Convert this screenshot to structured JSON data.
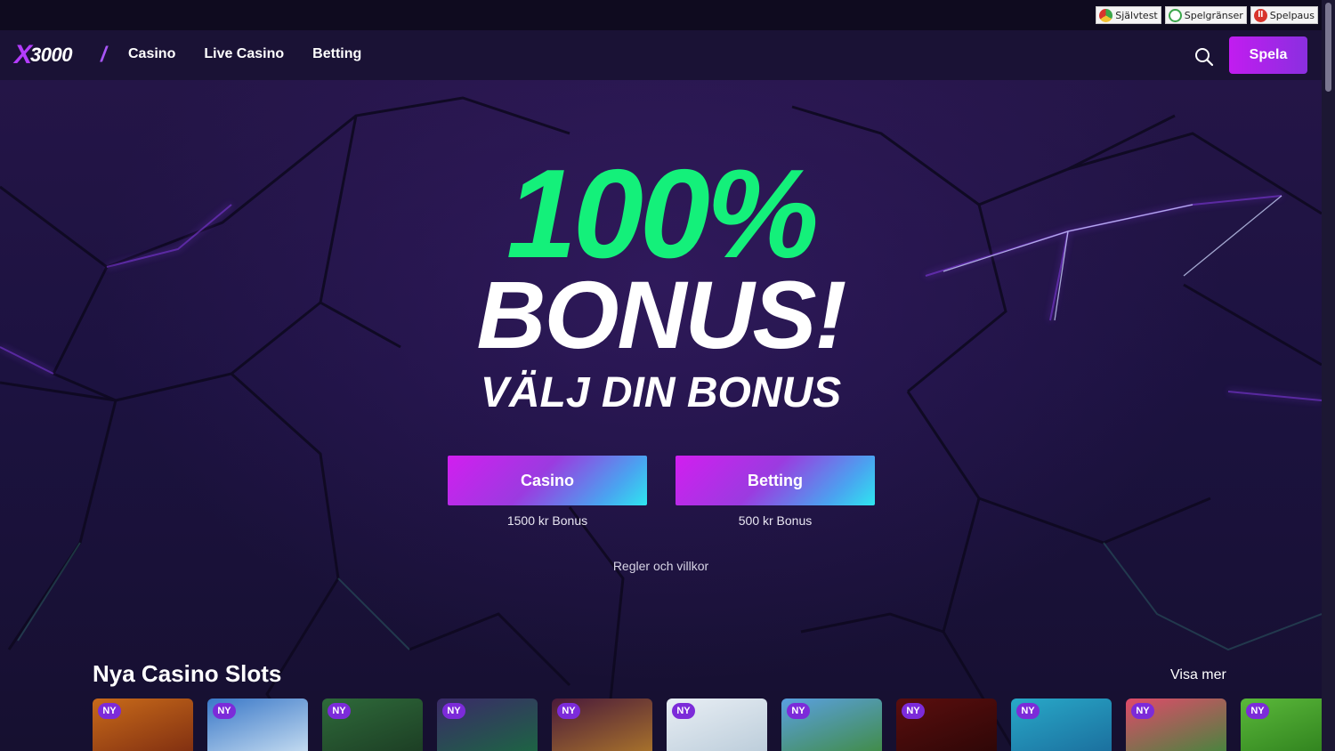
{
  "responsible_gaming": {
    "links": [
      {
        "label": "Självtest",
        "icon": "gauge-icon"
      },
      {
        "label": "Spelgränser",
        "icon": "limits-icon"
      },
      {
        "label": "Spelpaus",
        "icon": "pause-icon"
      }
    ]
  },
  "header": {
    "logo_x": "X",
    "logo_num": "3000",
    "nav": [
      {
        "label": "Casino"
      },
      {
        "label": "Live Casino"
      },
      {
        "label": "Betting"
      }
    ],
    "cta_label": "Spela"
  },
  "hero": {
    "headline_pct": "100%",
    "headline_bonus": "BONUS!",
    "headline_sub": "VÄLJ DIN BONUS",
    "options": [
      {
        "label": "Casino",
        "caption": "1500 kr Bonus"
      },
      {
        "label": "Betting",
        "caption": "500 kr Bonus"
      }
    ],
    "terms_label": "Regler och villkor"
  },
  "new_slots": {
    "title": "Nya Casino Slots",
    "see_more": "Visa mer",
    "badge": "NY",
    "tiles": [
      {
        "colors": [
          "#c86a1a",
          "#7a2a10"
        ]
      },
      {
        "colors": [
          "#3a78c8",
          "#d0e4f4"
        ]
      },
      {
        "colors": [
          "#2e6a3a",
          "#1b3a22"
        ]
      },
      {
        "colors": [
          "#3a2a68",
          "#1a6a40"
        ]
      },
      {
        "colors": [
          "#4a1a3a",
          "#b07a2a"
        ]
      },
      {
        "colors": [
          "#e8eef4",
          "#b8cad8"
        ]
      },
      {
        "colors": [
          "#5aa0e0",
          "#3f8a3a"
        ]
      },
      {
        "colors": [
          "#5a0e0e",
          "#2a0606"
        ]
      },
      {
        "colors": [
          "#28a8c8",
          "#1a6a9a"
        ]
      },
      {
        "colors": [
          "#e04a6a",
          "#3a8a3a"
        ]
      },
      {
        "colors": [
          "#5ab83a",
          "#2a7a1a"
        ]
      }
    ]
  },
  "colors": {
    "accent_green": "#14f07a",
    "accent_purple": "#b43cff",
    "cta_gradient_start": "#c21cf0",
    "cta_gradient_end": "#8a2fe0"
  }
}
